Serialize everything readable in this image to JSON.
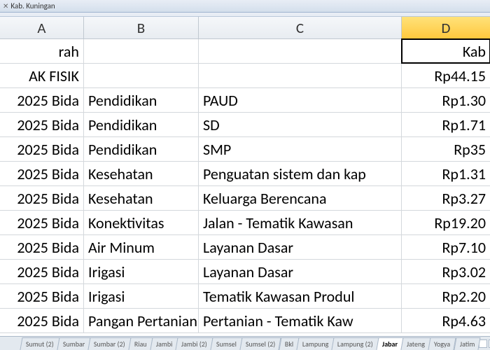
{
  "title": "Kab. Kuningan",
  "columns": {
    "a": "A",
    "b": "B",
    "c": "C",
    "d": "D"
  },
  "rows": [
    {
      "a": "rah",
      "b": "",
      "c": "",
      "d": "Kab"
    },
    {
      "a": "AK FISIK",
      "b": "",
      "c": "",
      "d": "Rp44.15"
    },
    {
      "a": " 2025 Bida",
      "b": "Pendidikan",
      "c": "PAUD",
      "d": "Rp1.30"
    },
    {
      "a": " 2025 Bida",
      "b": "Pendidikan",
      "c": "SD",
      "d": "Rp1.71"
    },
    {
      "a": " 2025 Bida",
      "b": "Pendidikan",
      "c": "SMP",
      "d": "Rp35"
    },
    {
      "a": " 2025 Bida",
      "b": "Kesehatan",
      "c": "Penguatan sistem dan kap",
      "d": "Rp1.31"
    },
    {
      "a": " 2025 Bida",
      "b": "Kesehatan",
      "c": "Keluarga Berencana",
      "d": "Rp3.27"
    },
    {
      "a": " 2025 Bida",
      "b": "Konektivitas",
      "c": "Jalan - Tematik Kawasan",
      "d": "Rp19.20"
    },
    {
      "a": " 2025 Bida",
      "b": "Air Minum",
      "c": "Layanan Dasar",
      "d": "Rp7.10"
    },
    {
      "a": " 2025 Bida",
      "b": "Irigasi",
      "c": "Layanan Dasar",
      "d": "Rp3.02"
    },
    {
      "a": " 2025 Bida",
      "b": "Irigasi",
      "c": "Tematik Kawasan Produl",
      "d": "Rp2.20"
    },
    {
      "a": " 2025 Bida",
      "b": "Pangan Pertanian",
      "c": "Pertanian - Tematik Kaw",
      "d": "Rp4.63"
    }
  ],
  "tabs": [
    "Sumut (2)",
    "Sumbar",
    "Sumbar (2)",
    "Riau",
    "Jambi",
    "Jambi (2)",
    "Sumsel",
    "Sumsel (2)",
    "Bkl",
    "Lampung",
    "Lampung (2)",
    "Jabar",
    "Jateng",
    "Yogya",
    "Jatim"
  ],
  "active_tab": "Jabar"
}
